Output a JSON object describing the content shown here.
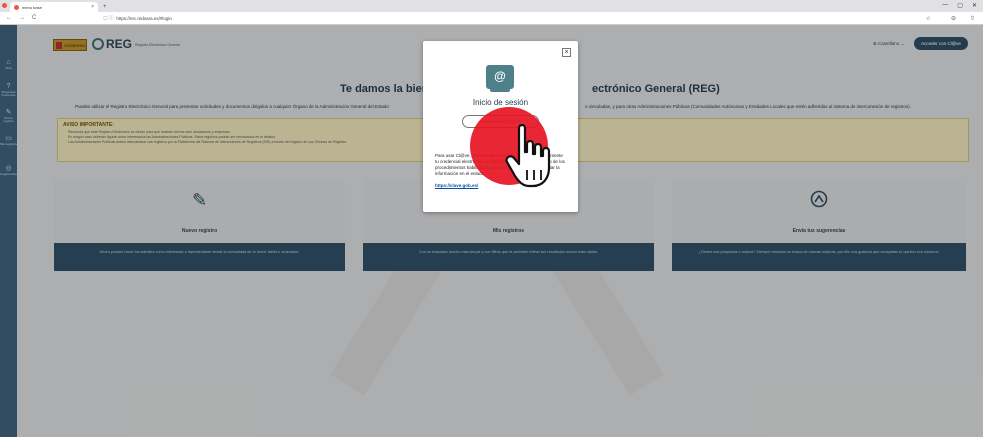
{
  "browser": {
    "tab_title": "menu base",
    "tab_close": "×",
    "new_tab": "+",
    "back": "←",
    "forward": "→",
    "reload": "C",
    "url_icons": "▢ ⓘ",
    "url": "https://rec.redsara.es/#login",
    "star": "☆",
    "ext1": "⊖",
    "ext2": "⇧",
    "win_min": "—",
    "win_max": "▢",
    "win_close": "✕"
  },
  "sidenav": {
    "items": [
      {
        "icon": "⌂",
        "label": "Inicio"
      },
      {
        "icon": "?",
        "label": "Preguntas frecuentes"
      },
      {
        "icon": "✎",
        "label": "Nuevo registro"
      },
      {
        "icon": "▭",
        "label": "Mis registros"
      },
      {
        "icon": "◎",
        "label": "Sugerencias"
      }
    ]
  },
  "header": {
    "gob_text": "GOBIERNO",
    "reg_text": "REG",
    "reg_sub": "Registro Electrónico General",
    "lang": "Castellano",
    "lang_icon": "⊕",
    "acceder": "Acceder con Cl@ve"
  },
  "welcome": {
    "left": "Te damos la bienve",
    "right": "ectrónico General (REG)",
    "intro_left": "Puedes utilizar el Registro Electrónico General para presentar solicitudes y documentos dirigidos a cualquier Órgano de la Administración General del Estado",
    "intro_right": "o vinculadas, y para otras Administraciones Públicas (Comunidades Autónomas y Entidades Locales que estén adheridas al sistema de interconexión de registros)."
  },
  "notice": {
    "title": "AVISO IMPORTANTE:",
    "items": [
      "Recuerda que este Registro Electrónico se ofrece para que realicen envíos sólo ciudadanos y empresas.",
      "En ningún caso deberán figurar como interesados las Administraciones Públicas. Estos registros podrán ser rechazados en el destino.",
      "Las Administraciones Públicas deben intercambiar sus registros por la Plataforma del Sistema de Interconexión de Registros (SIR) a través del registro de sus Oficinas de Registro."
    ]
  },
  "cards": [
    {
      "icon": "✎",
      "title": "Nuevo registro",
      "desc": "Ahora puedes hacer tus trámites como interesado o representante desde la comodidad de tu móvil, tablet u ordenador."
    },
    {
      "icon": "",
      "title": "Mis registros",
      "desc": "Con un buscador mucho más simple y con filtros que te permiten refinar tus resultados mucho más rápido."
    },
    {
      "icon": "⌃",
      "title": "Envía tus sugerencias",
      "desc": "¿Tienes una propuesta o mejora? Siempre estamos en busca de nuevas mejoras, por ello nos gustaría que compartas tu opinión con nosotros."
    }
  ],
  "modal": {
    "close": "×",
    "icon": "@",
    "title": "Inicio de sesión",
    "clave_button": "Acceder con Cl@ve",
    "text": "Para usar Cl@ve, únicamente necesitas registrarte previamente tu credencial electrónica de identificación mediante alguno de los procedimientos habilitados por el sistema. Puedes consultar la información en el enlace",
    "link": "https://clave.gob.es/"
  }
}
